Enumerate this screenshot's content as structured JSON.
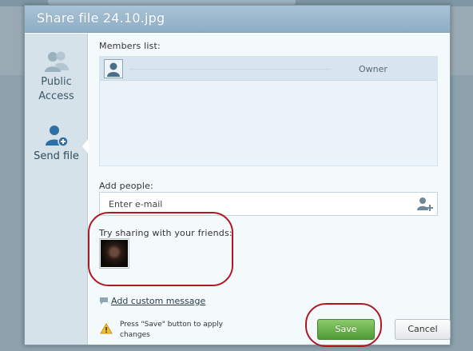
{
  "dialog": {
    "title": "Share file 24.10.jpg"
  },
  "sidebar": {
    "items": [
      {
        "label_line1": "Public",
        "label_line2": "Access",
        "icon": "group-icon",
        "active": false
      },
      {
        "label": "Send file",
        "icon": "user-add-icon",
        "active": true
      }
    ]
  },
  "members": {
    "label": "Members list:",
    "rows": [
      {
        "role": "Owner"
      }
    ]
  },
  "add_people": {
    "label": "Add people:",
    "placeholder": "Enter e-mail"
  },
  "friends": {
    "label": "Try sharing with your friends:"
  },
  "custom_message": {
    "link": "Add custom message"
  },
  "notice": {
    "text": "Press \"Save\" button to apply changes"
  },
  "buttons": {
    "save": "Save",
    "cancel": "Cancel"
  },
  "colors": {
    "title_bar": "#9db9ce",
    "sidebar": "#d5e2ea",
    "save_button": "#5aa63f",
    "annotation": "#b01821"
  }
}
